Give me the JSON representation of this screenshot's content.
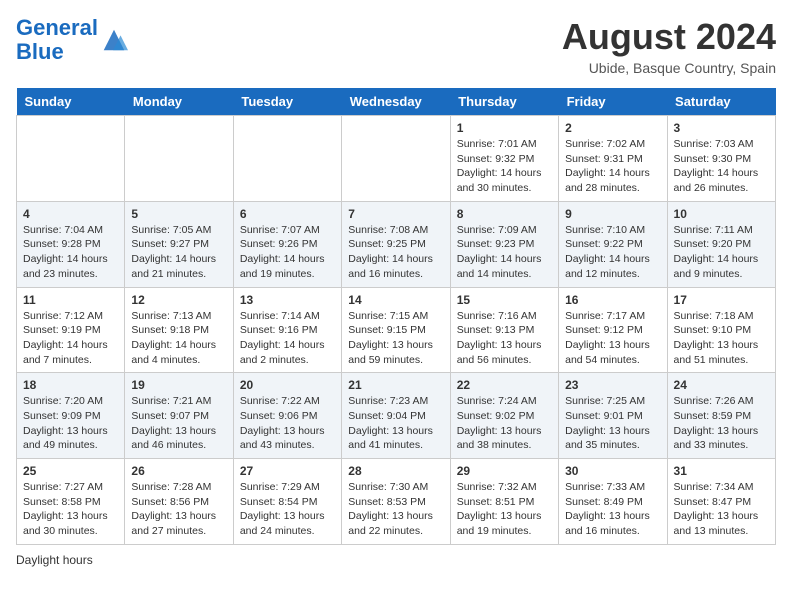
{
  "header": {
    "logo_line1": "General",
    "logo_line2": "Blue",
    "title": "August 2024",
    "subtitle": "Ubide, Basque Country, Spain"
  },
  "days_of_week": [
    "Sunday",
    "Monday",
    "Tuesday",
    "Wednesday",
    "Thursday",
    "Friday",
    "Saturday"
  ],
  "weeks": [
    [
      {
        "day": "",
        "info": ""
      },
      {
        "day": "",
        "info": ""
      },
      {
        "day": "",
        "info": ""
      },
      {
        "day": "",
        "info": ""
      },
      {
        "day": "1",
        "info": "Sunrise: 7:01 AM\nSunset: 9:32 PM\nDaylight: 14 hours\nand 30 minutes."
      },
      {
        "day": "2",
        "info": "Sunrise: 7:02 AM\nSunset: 9:31 PM\nDaylight: 14 hours\nand 28 minutes."
      },
      {
        "day": "3",
        "info": "Sunrise: 7:03 AM\nSunset: 9:30 PM\nDaylight: 14 hours\nand 26 minutes."
      }
    ],
    [
      {
        "day": "4",
        "info": "Sunrise: 7:04 AM\nSunset: 9:28 PM\nDaylight: 14 hours\nand 23 minutes."
      },
      {
        "day": "5",
        "info": "Sunrise: 7:05 AM\nSunset: 9:27 PM\nDaylight: 14 hours\nand 21 minutes."
      },
      {
        "day": "6",
        "info": "Sunrise: 7:07 AM\nSunset: 9:26 PM\nDaylight: 14 hours\nand 19 minutes."
      },
      {
        "day": "7",
        "info": "Sunrise: 7:08 AM\nSunset: 9:25 PM\nDaylight: 14 hours\nand 16 minutes."
      },
      {
        "day": "8",
        "info": "Sunrise: 7:09 AM\nSunset: 9:23 PM\nDaylight: 14 hours\nand 14 minutes."
      },
      {
        "day": "9",
        "info": "Sunrise: 7:10 AM\nSunset: 9:22 PM\nDaylight: 14 hours\nand 12 minutes."
      },
      {
        "day": "10",
        "info": "Sunrise: 7:11 AM\nSunset: 9:20 PM\nDaylight: 14 hours\nand 9 minutes."
      }
    ],
    [
      {
        "day": "11",
        "info": "Sunrise: 7:12 AM\nSunset: 9:19 PM\nDaylight: 14 hours\nand 7 minutes."
      },
      {
        "day": "12",
        "info": "Sunrise: 7:13 AM\nSunset: 9:18 PM\nDaylight: 14 hours\nand 4 minutes."
      },
      {
        "day": "13",
        "info": "Sunrise: 7:14 AM\nSunset: 9:16 PM\nDaylight: 14 hours\nand 2 minutes."
      },
      {
        "day": "14",
        "info": "Sunrise: 7:15 AM\nSunset: 9:15 PM\nDaylight: 13 hours\nand 59 minutes."
      },
      {
        "day": "15",
        "info": "Sunrise: 7:16 AM\nSunset: 9:13 PM\nDaylight: 13 hours\nand 56 minutes."
      },
      {
        "day": "16",
        "info": "Sunrise: 7:17 AM\nSunset: 9:12 PM\nDaylight: 13 hours\nand 54 minutes."
      },
      {
        "day": "17",
        "info": "Sunrise: 7:18 AM\nSunset: 9:10 PM\nDaylight: 13 hours\nand 51 minutes."
      }
    ],
    [
      {
        "day": "18",
        "info": "Sunrise: 7:20 AM\nSunset: 9:09 PM\nDaylight: 13 hours\nand 49 minutes."
      },
      {
        "day": "19",
        "info": "Sunrise: 7:21 AM\nSunset: 9:07 PM\nDaylight: 13 hours\nand 46 minutes."
      },
      {
        "day": "20",
        "info": "Sunrise: 7:22 AM\nSunset: 9:06 PM\nDaylight: 13 hours\nand 43 minutes."
      },
      {
        "day": "21",
        "info": "Sunrise: 7:23 AM\nSunset: 9:04 PM\nDaylight: 13 hours\nand 41 minutes."
      },
      {
        "day": "22",
        "info": "Sunrise: 7:24 AM\nSunset: 9:02 PM\nDaylight: 13 hours\nand 38 minutes."
      },
      {
        "day": "23",
        "info": "Sunrise: 7:25 AM\nSunset: 9:01 PM\nDaylight: 13 hours\nand 35 minutes."
      },
      {
        "day": "24",
        "info": "Sunrise: 7:26 AM\nSunset: 8:59 PM\nDaylight: 13 hours\nand 33 minutes."
      }
    ],
    [
      {
        "day": "25",
        "info": "Sunrise: 7:27 AM\nSunset: 8:58 PM\nDaylight: 13 hours\nand 30 minutes."
      },
      {
        "day": "26",
        "info": "Sunrise: 7:28 AM\nSunset: 8:56 PM\nDaylight: 13 hours\nand 27 minutes."
      },
      {
        "day": "27",
        "info": "Sunrise: 7:29 AM\nSunset: 8:54 PM\nDaylight: 13 hours\nand 24 minutes."
      },
      {
        "day": "28",
        "info": "Sunrise: 7:30 AM\nSunset: 8:53 PM\nDaylight: 13 hours\nand 22 minutes."
      },
      {
        "day": "29",
        "info": "Sunrise: 7:32 AM\nSunset: 8:51 PM\nDaylight: 13 hours\nand 19 minutes."
      },
      {
        "day": "30",
        "info": "Sunrise: 7:33 AM\nSunset: 8:49 PM\nDaylight: 13 hours\nand 16 minutes."
      },
      {
        "day": "31",
        "info": "Sunrise: 7:34 AM\nSunset: 8:47 PM\nDaylight: 13 hours\nand 13 minutes."
      }
    ]
  ],
  "footer": {
    "note": "Daylight hours"
  }
}
